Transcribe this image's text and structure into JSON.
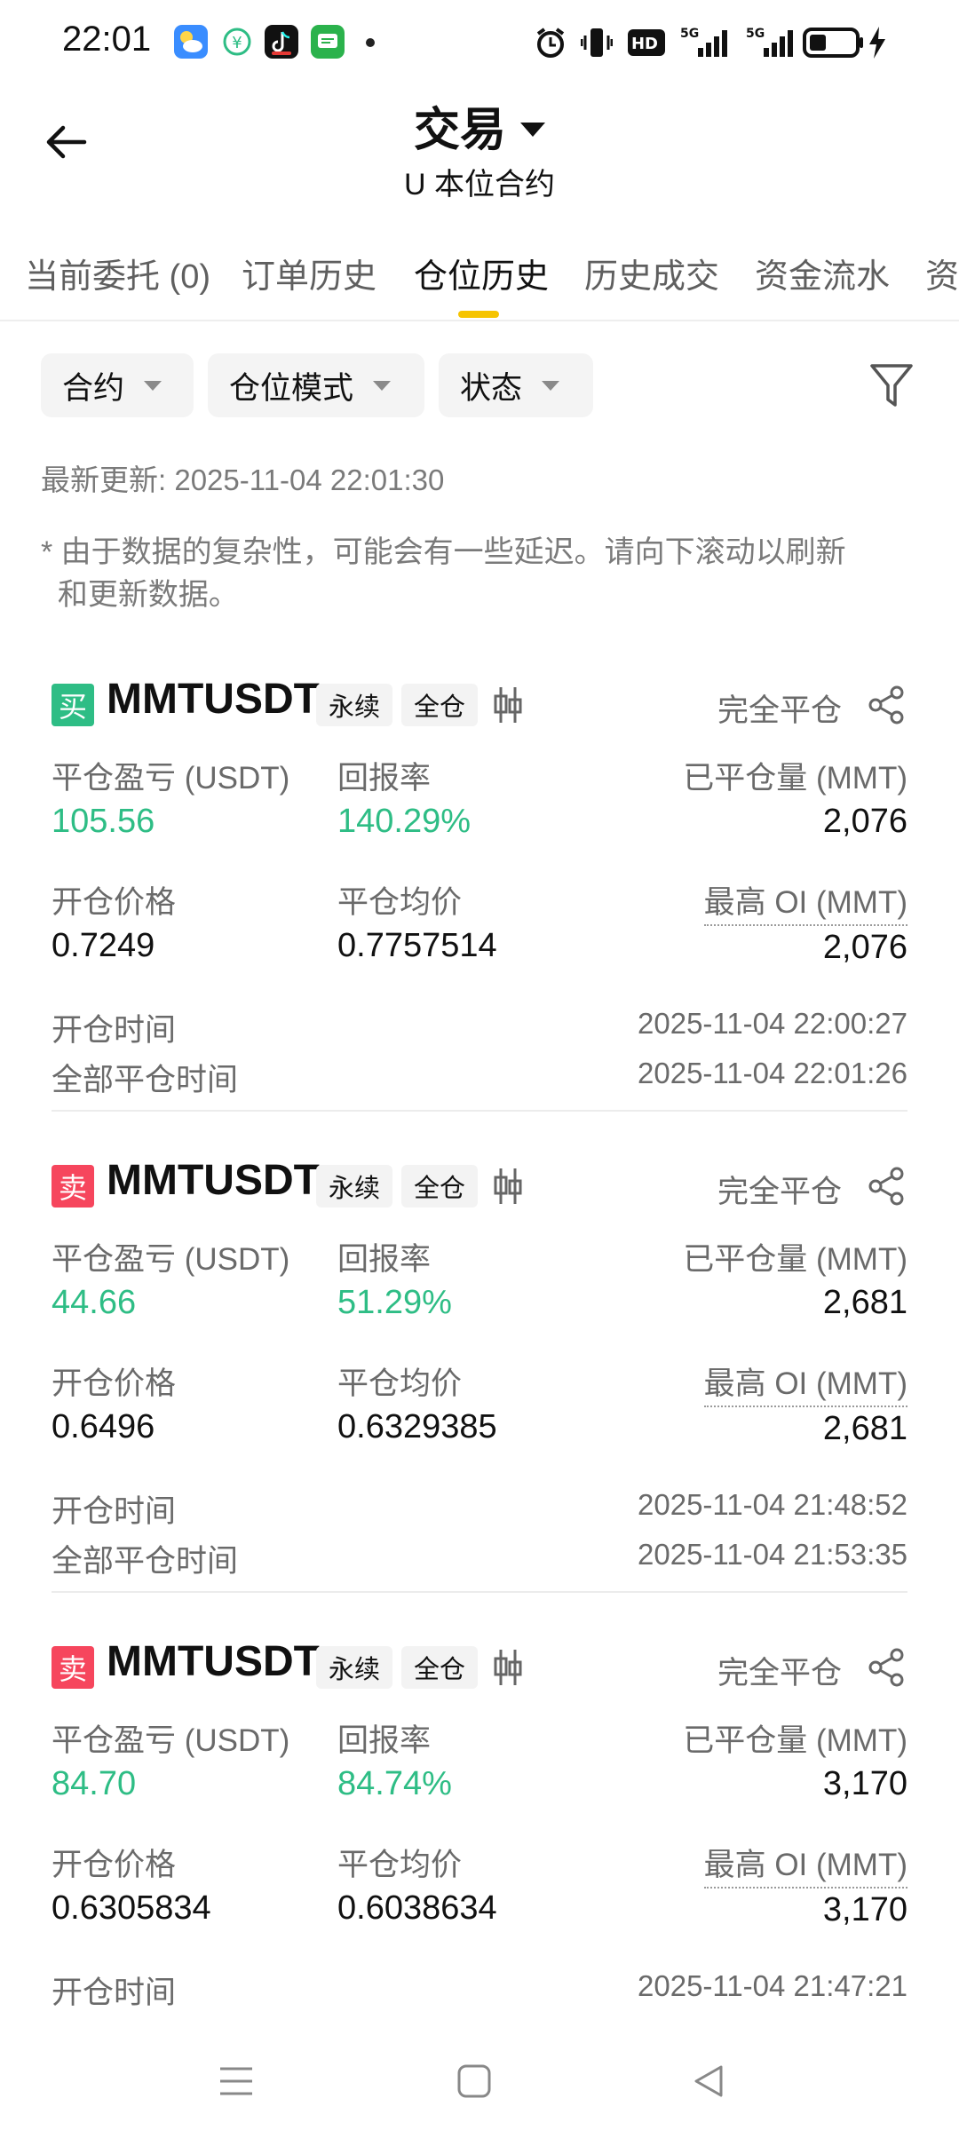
{
  "status_bar": {
    "time": "22:01",
    "icons": [
      "weather-app-icon",
      "app-icon",
      "tiktok-icon",
      "messages-icon",
      "alarm-icon",
      "vibrate-icon",
      "hd-icon",
      "5g-signal-icon",
      "5g-signal-icon",
      "battery-icon",
      "charging-icon"
    ],
    "hd_label": "HD",
    "net1": "5G",
    "net2": "5G"
  },
  "header": {
    "title": "交易",
    "subtitle": "U 本位合约"
  },
  "tabs": [
    {
      "label": "当前委托 (0)"
    },
    {
      "label": "订单历史"
    },
    {
      "label": "仓位历史"
    },
    {
      "label": "历史成交"
    },
    {
      "label": "资金流水"
    },
    {
      "label": "资"
    }
  ],
  "active_tab": "仓位历史",
  "filters": [
    {
      "label": "合约"
    },
    {
      "label": "仓位模式"
    },
    {
      "label": "状态"
    }
  ],
  "last_updated": "最新更新: 2025-11-04 22:01:30",
  "disclaimer": "* 由于数据的复杂性，可能会有一些延迟。请向下滚动以刷新\n  和更新数据。",
  "colors": {
    "accent": "#f6c400",
    "buy": "#2ebd85",
    "sell": "#f6465d",
    "profit": "#2ebd85"
  },
  "labels": {
    "pnl": "平仓盈亏 (USDT)",
    "roi": "回报率",
    "closed_qty": "已平仓量 (MMT)",
    "open_price": "开仓价格",
    "avg_close_price": "平仓均价",
    "max_oi": "最高 OI (MMT)",
    "open_time": "开仓时间",
    "full_close_time": "全部平仓时间"
  },
  "positions": [
    {
      "side": "买",
      "side_color": "#2ebd85",
      "symbol": "MMTUSDT",
      "tag_perpetual": "永续",
      "tag_margin": "全仓",
      "status": "完全平仓",
      "pnl": "105.56",
      "roi": "140.29%",
      "closed_qty": "2,076",
      "open_price": "0.7249",
      "avg_close_price": "0.7757514",
      "max_oi": "2,076",
      "open_time": "2025-11-04 22:00:27",
      "full_close_time": "2025-11-04 22:01:26"
    },
    {
      "side": "卖",
      "side_color": "#f6465d",
      "symbol": "MMTUSDT",
      "tag_perpetual": "永续",
      "tag_margin": "全仓",
      "status": "完全平仓",
      "pnl": "44.66",
      "roi": "51.29%",
      "closed_qty": "2,681",
      "open_price": "0.6496",
      "avg_close_price": "0.6329385",
      "max_oi": "2,681",
      "open_time": "2025-11-04 21:48:52",
      "full_close_time": "2025-11-04 21:53:35"
    },
    {
      "side": "卖",
      "side_color": "#f6465d",
      "symbol": "MMTUSDT",
      "tag_perpetual": "永续",
      "tag_margin": "全仓",
      "status": "完全平仓",
      "pnl": "84.70",
      "roi": "84.74%",
      "closed_qty": "3,170",
      "open_price": "0.6305834",
      "avg_close_price": "0.6038634",
      "max_oi": "3,170",
      "open_time": "2025-11-04 21:47:21"
    }
  ],
  "nav_bar": [
    "menu-icon",
    "home-icon",
    "back-triangle-icon"
  ]
}
